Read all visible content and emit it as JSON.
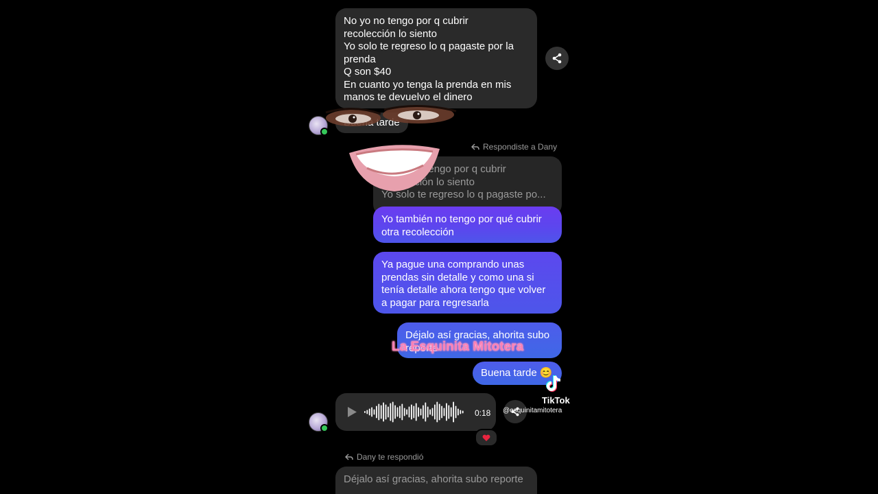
{
  "messages": {
    "received_1": [
      "No yo no tengo por q cubrir",
      "recolección lo siento",
      "Yo solo te regreso lo q pagaste por la",
      "prenda",
      "Q son $40",
      "En cuanto yo tenga la prenda en mis",
      "manos te devuelvo el dinero"
    ],
    "received_2": "Buena tarde",
    "reply_label": "Respondiste a Dany",
    "quoted": [
      "No yo no tengo por q cubrir",
      "recolección lo siento",
      "Yo solo te regreso lo q pagaste po..."
    ],
    "sent_1": [
      "Yo también no tengo por qué cubrir",
      "otra recolección"
    ],
    "sent_2": [
      "Ya pague una comprando unas",
      "prendas sin detalle y como una si",
      "tenía detalle ahora tengo que volver",
      "a pagar para regresarla"
    ],
    "sent_3": [
      "Déjalo así gracias, ahorita subo",
      "reporte"
    ],
    "sent_4": "Buena tarde 😊",
    "audio_duration": "0:18",
    "reaction": "❤️",
    "reply_label_2": "Dany te respondió",
    "received_3": "Déjalo así gracias, ahorita subo reporte"
  },
  "overlay": {
    "watermark": "La Esquinita Mitotera",
    "tiktok_brand": "TikTok",
    "tiktok_user": "@esquinitamitotera"
  },
  "colors": {
    "background": "#000000",
    "incoming_bubble": "#2a2a2a",
    "outgoing_start": "#6b3cf0",
    "outgoing_end": "#3f68e6",
    "online_dot": "#35c759",
    "watermark": "#ff7fb3"
  },
  "icons": [
    "share-icon",
    "reply-arrow-icon",
    "play-icon",
    "waveform",
    "heart-icon",
    "tiktok-icon"
  ]
}
